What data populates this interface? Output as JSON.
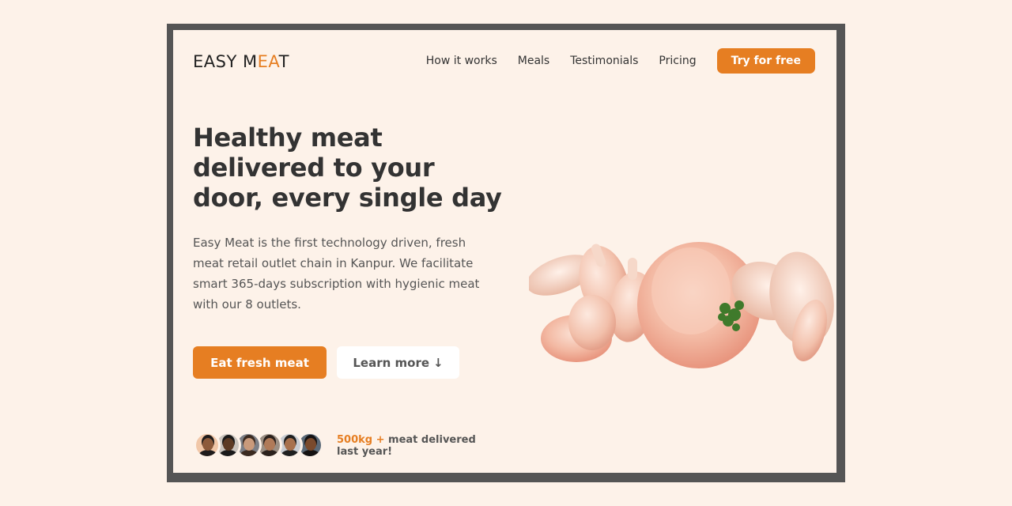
{
  "brand": {
    "logo_part1": "EASY M",
    "logo_accent": "EA",
    "logo_part2": "T",
    "accent_color": "#e67e22"
  },
  "nav": {
    "items": [
      {
        "label": "How it works"
      },
      {
        "label": "Meals"
      },
      {
        "label": "Testimonials"
      },
      {
        "label": "Pricing"
      }
    ],
    "cta_label": "Try for free"
  },
  "hero": {
    "title": "Healthy meat delivered to your door, every single day",
    "description": "Easy Meat is the first technology driven, fresh meat retail outlet chain in Kanpur. We facilitate smart 365-days subscription with hygienic meat with our 8 outlets.",
    "primary_button": "Eat fresh meat",
    "secondary_button": "Learn more",
    "secondary_icon": "↓"
  },
  "delivered": {
    "amount": "500kg +",
    "text": " meat delivered last year!"
  },
  "avatars": [
    {
      "name": "customer-1",
      "skin": "#8d5a3b",
      "bg": "#f1c7a8",
      "hair": "#1e1b1b"
    },
    {
      "name": "customer-2",
      "skin": "#5c3a24",
      "bg": "#c9c3bd",
      "hair": "#1a1a1a"
    },
    {
      "name": "customer-3",
      "skin": "#c99a7b",
      "bg": "#7c7f86",
      "hair": "#3b2a20"
    },
    {
      "name": "customer-4",
      "skin": "#b07a58",
      "bg": "#9b8f84",
      "hair": "#2b211c"
    },
    {
      "name": "customer-5",
      "skin": "#a8714d",
      "bg": "#c8ccd2",
      "hair": "#1f1f1f"
    },
    {
      "name": "customer-6",
      "skin": "#7a4a2c",
      "bg": "#5b6a78",
      "hair": "#151212"
    }
  ]
}
